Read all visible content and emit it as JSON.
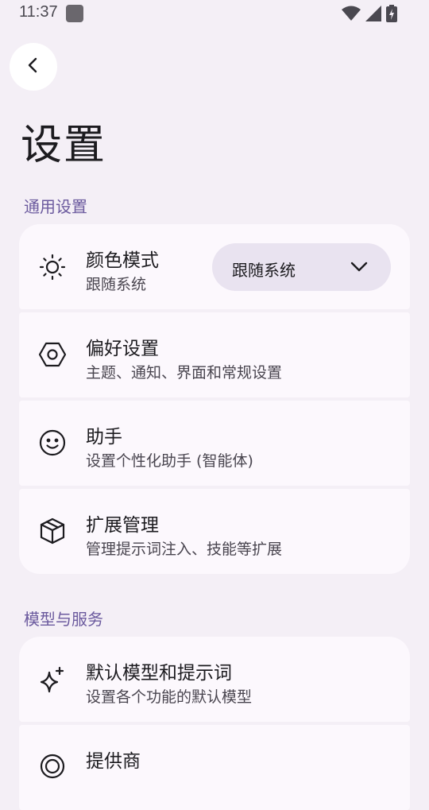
{
  "status_bar": {
    "time": "11:37"
  },
  "page": {
    "title": "设置"
  },
  "sections": [
    {
      "header": "通用设置",
      "items": [
        {
          "title": "颜色模式",
          "subtitle": "跟随系统",
          "icon": "sun-icon",
          "dropdown_value": "跟随系统"
        },
        {
          "title": "偏好设置",
          "subtitle": "主题、通知、界面和常规设置",
          "icon": "hexagon-settings-icon"
        },
        {
          "title": "助手",
          "subtitle": "设置个性化助手 (智能体)",
          "icon": "smile-face-icon"
        },
        {
          "title": "扩展管理",
          "subtitle": "管理提示词注入、技能等扩展",
          "icon": "package-box-icon"
        }
      ]
    },
    {
      "header": "模型与服务",
      "items": [
        {
          "title": "默认模型和提示词",
          "subtitle": "设置各个功能的默认模型",
          "icon": "sparkles-icon"
        },
        {
          "title": "提供商",
          "subtitle": "",
          "icon": "provider-icon"
        }
      ]
    }
  ],
  "colors": {
    "background": "#f4eff6",
    "card": "#fcf8fd",
    "section_header": "#6b5a9e",
    "dropdown_bg": "#e9e3f0"
  }
}
